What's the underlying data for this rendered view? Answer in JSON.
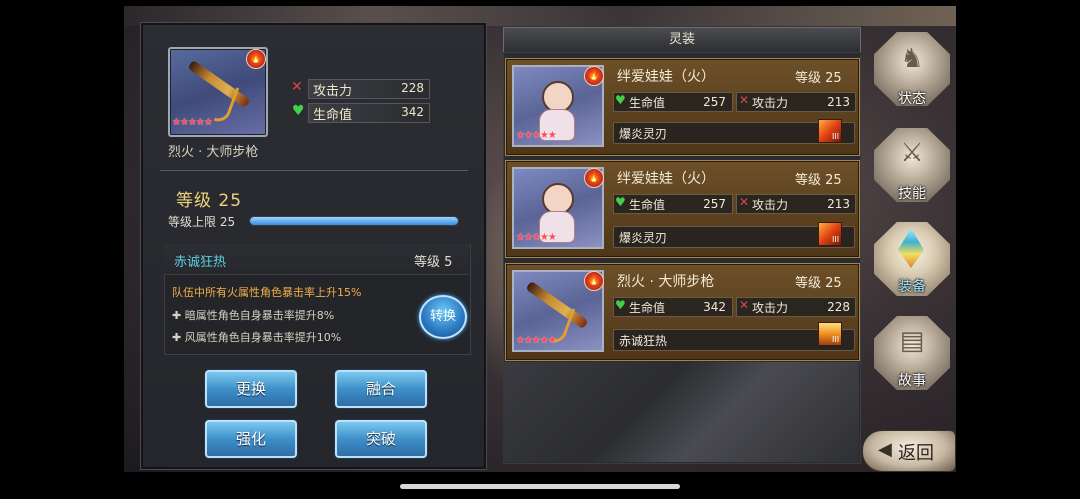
{
  "selected_item": {
    "name": "烈火 · 大师步枪",
    "stars": "★★★★★",
    "element_glyph": "🔥",
    "stats": [
      {
        "label": "攻击力",
        "value": "228",
        "icon": "sword-icon"
      },
      {
        "label": "生命值",
        "value": "342",
        "icon": "heart-icon"
      }
    ],
    "level_title": "等级 25",
    "level_cap_label": "等级上限 25",
    "level_progress": 1.0
  },
  "skill": {
    "name": "赤诚狂热",
    "level": "等级 5",
    "lines": [
      {
        "text": "队伍中所有火属性角色暴击率上升15%",
        "color": "#f3b04a"
      },
      {
        "text": "✚ 暗属性角色自身暴击率提升8%",
        "color": "#d8d2c2"
      },
      {
        "text": "✚ 风属性角色自身暴击率提升10%",
        "color": "#d8d2c2"
      }
    ],
    "convert_label": "转换"
  },
  "actions": {
    "replace": "更换",
    "fuse": "融合",
    "enhance": "强化",
    "breakthrough": "突破"
  },
  "list_panel": {
    "title": "灵装",
    "items": [
      {
        "name": "绊爱娃娃（火）",
        "level": "等级 25",
        "hp_label": "生命值",
        "hp": "257",
        "atk_label": "攻击力",
        "atk": "213",
        "skill": "爆炎灵刃",
        "skill_rank": "III",
        "thumb": "doll"
      },
      {
        "name": "绊爱娃娃（火）",
        "level": "等级 25",
        "hp_label": "生命值",
        "hp": "257",
        "atk_label": "攻击力",
        "atk": "213",
        "skill": "爆炎灵刃",
        "skill_rank": "III",
        "thumb": "doll"
      },
      {
        "name": "烈火 · 大师步枪",
        "level": "等级 25",
        "hp_label": "生命值",
        "hp": "342",
        "atk_label": "攻击力",
        "atk": "228",
        "skill": "赤诚狂热",
        "skill_rank": "III",
        "thumb": "rifle"
      }
    ]
  },
  "side_nav": [
    {
      "label": "状态",
      "icon": "character-icon",
      "active": false
    },
    {
      "label": "技能",
      "icon": "sword-emblem-icon",
      "active": false
    },
    {
      "label": "装备",
      "icon": "crystal-icon",
      "active": true
    },
    {
      "label": "故事",
      "icon": "book-icon",
      "active": false
    }
  ],
  "back_label": "返回",
  "colors": {
    "accent_blue": "#3d8fc8",
    "skill_name": "#5bd1e0",
    "level_gold": "#f1d27a",
    "card_brown": "#6d5029"
  }
}
